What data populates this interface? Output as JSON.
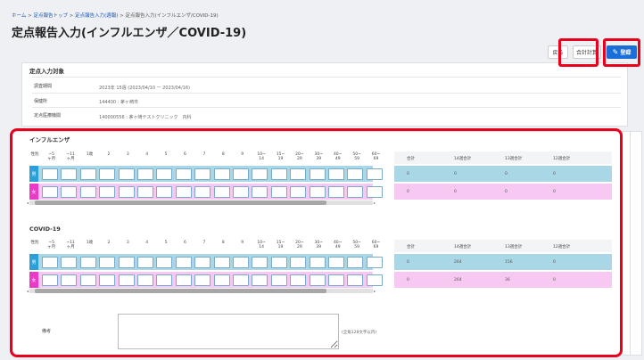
{
  "breadcrumb": {
    "items": [
      "ホーム",
      "定点報告トップ",
      "定点報告入力(週報)"
    ],
    "current": "定点報告入力(インフルエンザ/COVID-19)",
    "sep": ">"
  },
  "page_title": "定点報告入力(インフルエンザ／COVID-19)",
  "actions": {
    "back": "戻る",
    "calc": "合計計算",
    "register": "登録"
  },
  "target": {
    "title": "定点入力対象",
    "rows": [
      {
        "label": "調査期間",
        "value": "2023年 15週 (2023/04/10 ー 2023/04/16)"
      },
      {
        "label": "保健所",
        "value": "144400 : 茅ヶ崎市"
      },
      {
        "label": "定点医療機関",
        "value": "140000556 : 茅ヶ崎テストクリニック　内科"
      }
    ]
  },
  "age_headers": [
    "性別",
    "~5\nヶ月",
    "~11\nヶ月",
    "1歳",
    "2",
    "3",
    "4",
    "5",
    "6",
    "7",
    "8",
    "9",
    "10~\n14",
    "15~\n19",
    "20~\n29",
    "30~\n39",
    "40~\n49",
    "50~\n59",
    "60~\n69"
  ],
  "sex_labels": {
    "male": "男",
    "female": "女"
  },
  "sum_headers": [
    "合計",
    "14週合計",
    "13週合計",
    "12週合計"
  ],
  "influenza": {
    "title": "インフルエンザ",
    "male_sums": [
      "0",
      "0",
      "0",
      "0"
    ],
    "female_sums": [
      "0",
      "0",
      "0",
      "0"
    ]
  },
  "covid": {
    "title": "COVID-19",
    "male_sums": [
      "0",
      "264",
      "156",
      "0"
    ],
    "female_sums": [
      "0",
      "264",
      "36",
      "0"
    ]
  },
  "remarks": {
    "label": "備考",
    "hint": "(全角128文字以内)"
  },
  "colors": {
    "male": "#a9d7e6",
    "female": "#f7c9f2",
    "male_tag": "#2a9fd8",
    "female_tag": "#ea3ac7",
    "highlight": "#e8001c",
    "primary": "#1a6ed8"
  }
}
